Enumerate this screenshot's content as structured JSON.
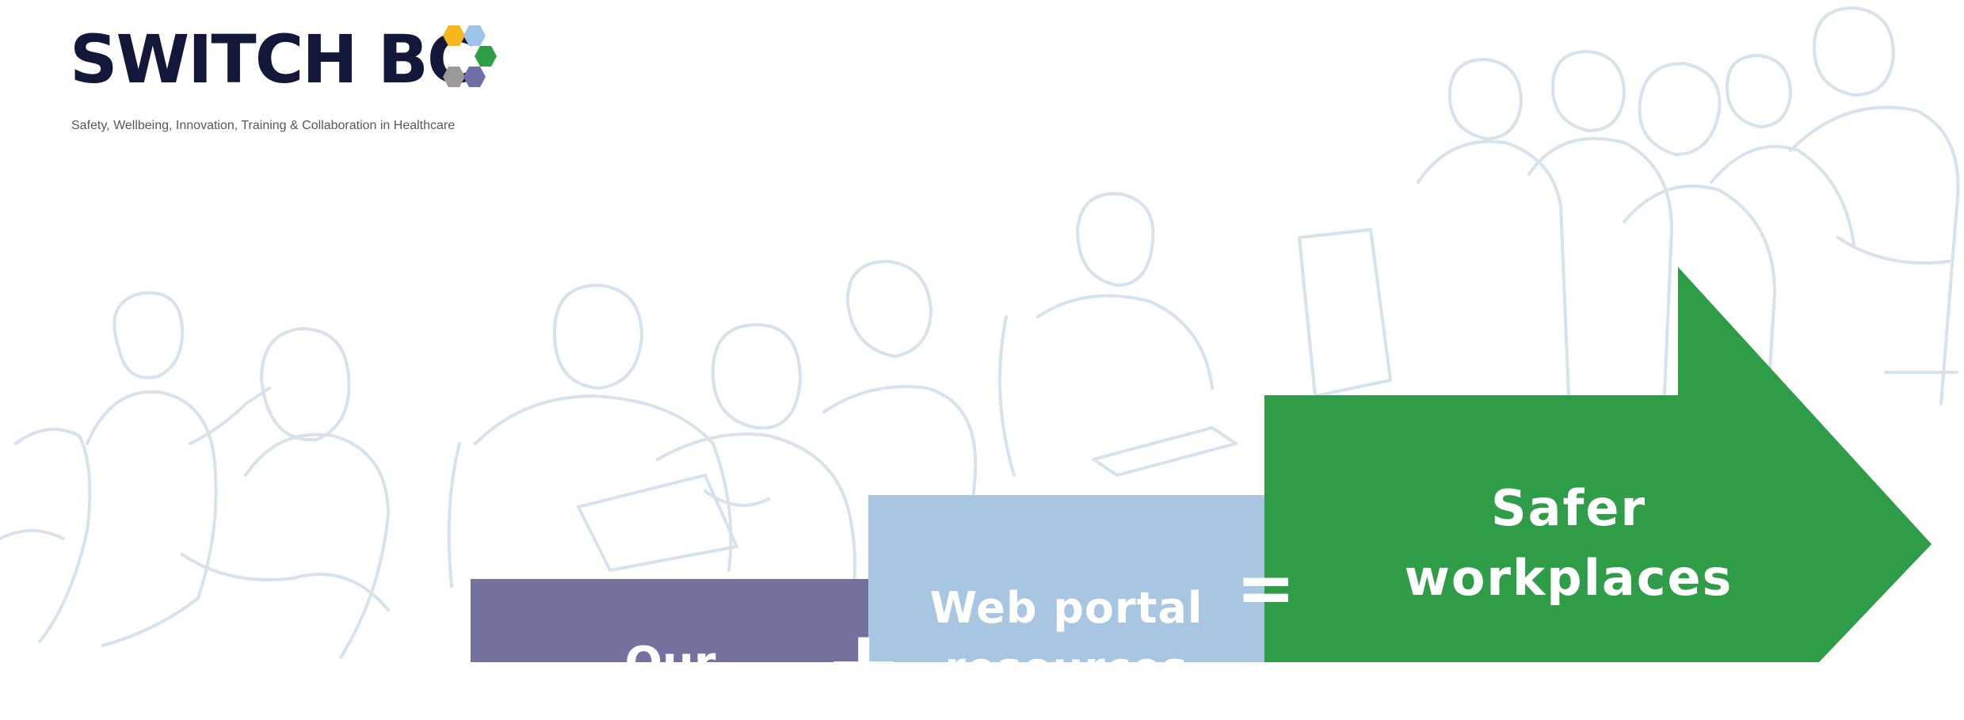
{
  "logo": {
    "name": "SWITCH BC",
    "tagline": "Safety, Wellbeing, Innovation, Training & Collaboration in Healthcare",
    "hex_colors": [
      "#f5b81c",
      "#9dc3e8",
      "#2f9c48",
      "#9a9a9a",
      "#6d6fa6"
    ]
  },
  "background": {
    "icon": "people-line-art-illustration",
    "line_color": "#d6e2ec"
  },
  "equation": {
    "term1": "Our",
    "plus_symbol": "+",
    "term2": "Web portal resources",
    "equals_symbol": "=",
    "result": "Safer workplaces"
  },
  "colors": {
    "purple": "#73729e",
    "light_blue": "#a8c6e1",
    "green": "#2f9c48",
    "navy": "#13173a"
  }
}
